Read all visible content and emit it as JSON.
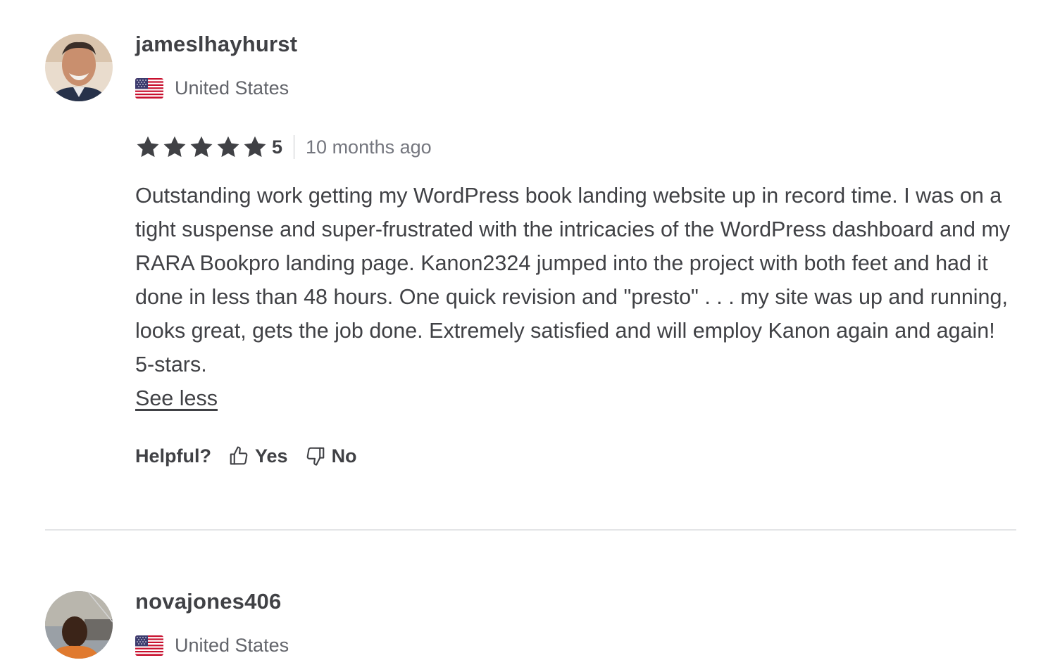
{
  "reviews": [
    {
      "username": "jameslhayhurst",
      "country": "United States",
      "rating": "5",
      "stars": 5,
      "time_ago": "10 months ago",
      "text": "Outstanding work getting my WordPress book landing website up in record time. I was on a tight suspense and super-frustrated with the intricacies of the WordPress dashboard and my RARA Bookpro landing page. Kanon2324 jumped into the project with both feet and had it done in less than 48 hours. One quick revision and \"presto\" . . . my site was up and running, looks great, gets the job done. Extremely satisfied and will employ Kanon again and again! 5-stars.",
      "see_less": "See less",
      "helpful_label": "Helpful?",
      "yes_label": "Yes",
      "no_label": "No"
    },
    {
      "username": "novajones406",
      "country": "United States"
    }
  ],
  "icons": {
    "star": "star-icon",
    "thumbs_up": "thumbs-up-icon",
    "thumbs_down": "thumbs-down-icon",
    "flag": "us-flag-icon"
  },
  "colors": {
    "text_primary": "#404145",
    "text_secondary": "#62646a",
    "text_muted": "#74767e",
    "divider": "#e4e5e7",
    "star": "#404145"
  }
}
